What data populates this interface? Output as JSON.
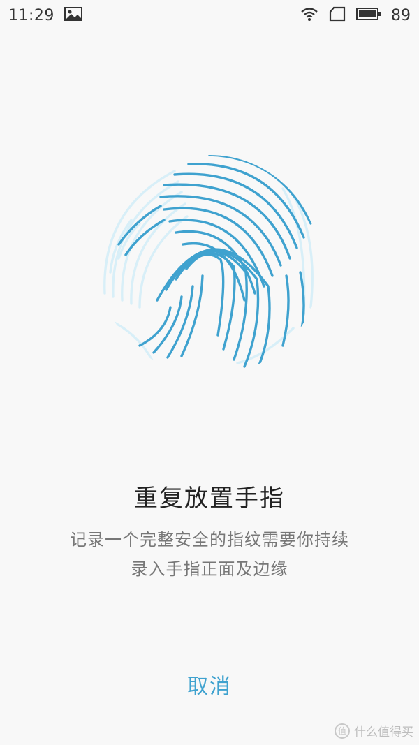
{
  "status_bar": {
    "time": "11:29",
    "battery_percent": "89",
    "icons": [
      "image-icon",
      "wifi-icon",
      "sim-icon",
      "battery-icon"
    ]
  },
  "fingerprint": {
    "icon": "fingerprint-icon",
    "colors": {
      "filled": "#3fa2cf",
      "pending": "#d8eff8"
    }
  },
  "main": {
    "title": "重复放置手指",
    "description_lines": [
      "记录一个完整安全的指纹需要你持续",
      "录入手指正面及边缘"
    ]
  },
  "actions": {
    "cancel_label": "取消"
  },
  "watermark": {
    "text": "什么值得买",
    "badge": "值"
  }
}
